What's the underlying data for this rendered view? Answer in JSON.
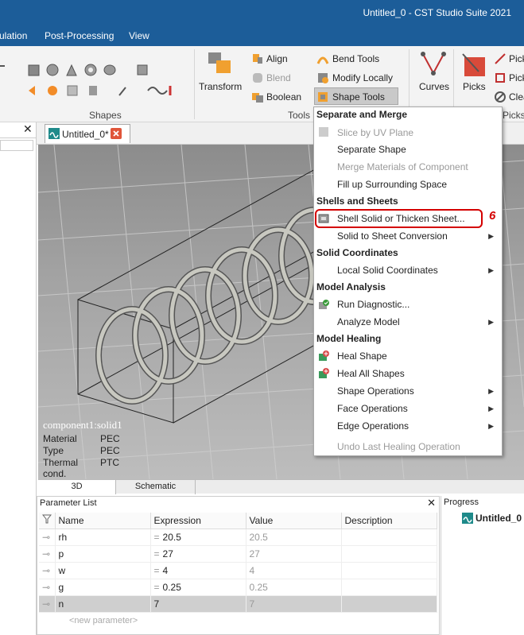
{
  "window": {
    "title": "Untitled_0 - CST Studio Suite 2021"
  },
  "menubar": {
    "items": [
      "ulation",
      "Post-Processing",
      "View"
    ]
  },
  "ribbon": {
    "groups": {
      "shapes": "Shapes",
      "tools": "Tools",
      "picks": "Picks"
    },
    "transform": "Transform",
    "align": "Align",
    "blend": "Blend",
    "boolean": "Boolean",
    "bend_tools": "Bend Tools",
    "modify_locally": "Modify Locally",
    "shape_tools": "Shape Tools",
    "curves": "Curves",
    "picks_btn": "Picks",
    "pick1": "Pick",
    "pick2": "Pick",
    "clear": "Clea"
  },
  "document": {
    "tab_label": "Untitled_0*"
  },
  "viewport": {
    "component_name": "component1:solid1",
    "properties": [
      {
        "key": "Material",
        "value": "PEC"
      },
      {
        "key": "Type",
        "value": "PEC"
      },
      {
        "key": "Thermal cond.",
        "value": "PTC"
      }
    ],
    "view_tabs": [
      "3D",
      "Schematic"
    ]
  },
  "dropdown": {
    "sections": {
      "separate_merge": "Separate and Merge",
      "shells_sheets": "Shells and Sheets",
      "solid_coords": "Solid Coordinates",
      "model_analysis": "Model Analysis",
      "model_healing": "Model Healing"
    },
    "items": {
      "slice_uv": "Slice by UV Plane",
      "separate_shape": "Separate Shape",
      "merge_materials": "Merge Materials of Component",
      "fill_up": "Fill up Surrounding Space",
      "shell_solid": "Shell Solid or Thicken Sheet...",
      "solid_to_sheet": "Solid to Sheet Conversion",
      "local_solid_coords": "Local Solid Coordinates",
      "run_diagnostic": "Run Diagnostic...",
      "analyze_model": "Analyze Model",
      "heal_shape": "Heal Shape",
      "heal_all": "Heal All Shapes",
      "shape_ops": "Shape Operations",
      "face_ops": "Face Operations",
      "edge_ops": "Edge Operations",
      "undo_healing": "Undo Last Healing Operation"
    },
    "step_annotation": "6"
  },
  "parameter_list": {
    "title": "Parameter List",
    "columns": [
      "Name",
      "Expression",
      "Value",
      "Description"
    ],
    "rows": [
      {
        "name": "rh",
        "expression": "20.5",
        "value": "20.5"
      },
      {
        "name": "p",
        "expression": "27",
        "value": "27"
      },
      {
        "name": "w",
        "expression": "4",
        "value": "4"
      },
      {
        "name": "g",
        "expression": "0.25",
        "value": "0.25"
      },
      {
        "name": "n",
        "expression": "7",
        "value": "7"
      }
    ],
    "new_parameter": "<new parameter>"
  },
  "progress": {
    "title": "Progress",
    "item": "Untitled_0"
  },
  "colors": {
    "title_bar": "#1c5d99",
    "highlight_red": "#d40000"
  }
}
